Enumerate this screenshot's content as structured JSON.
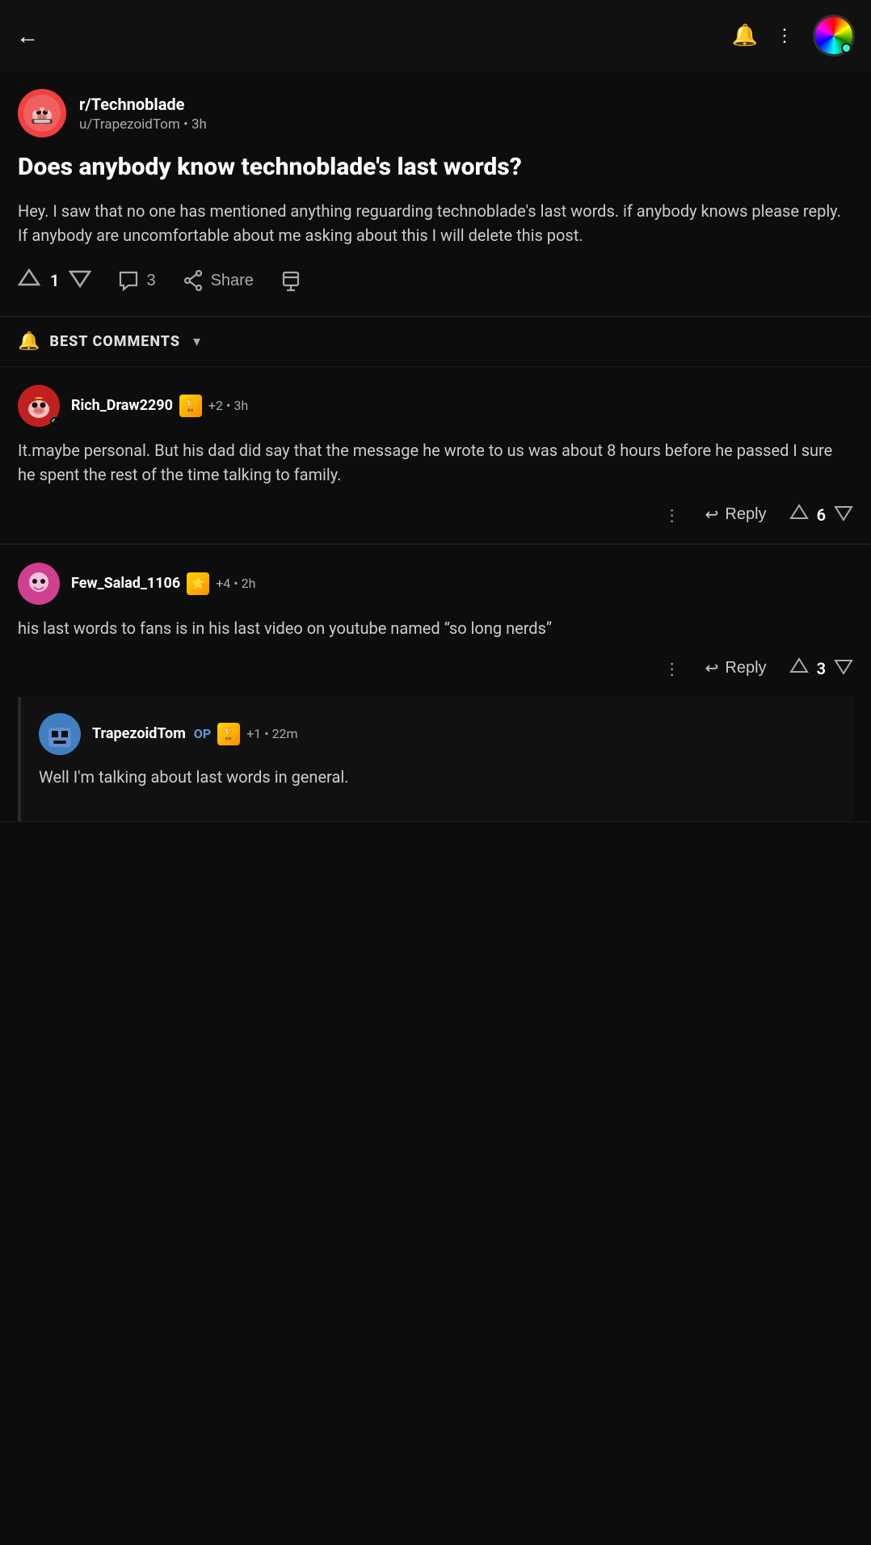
{
  "topbar": {
    "back_label": "←",
    "more_label": "⋮"
  },
  "post": {
    "subreddit": "r/Technoblade",
    "author": "u/TrapezoidTom",
    "time_ago": "3h",
    "title": "Does anybody know technoblade's last words?",
    "body": "Hey. I saw that no one has mentioned anything reguarding technoblade's last words. if anybody knows please reply. If anybody are uncomfortable about me asking about this I will delete this post.",
    "upvotes": "1",
    "comment_count": "3",
    "share_label": "Share"
  },
  "sort_bar": {
    "label": "BEST COMMENTS",
    "icon": "🔔"
  },
  "comments": [
    {
      "username": "Rich_Draw2290",
      "flair_points": "+2",
      "time_ago": "3h",
      "body": "It.maybe personal. But his dad did say that the message he wrote to us was about 8 hours before he passed I sure he spent the rest of the time talking to family.",
      "votes": "6",
      "reply_label": "Reply",
      "has_online": true
    },
    {
      "username": "Few_Salad_1106",
      "flair_points": "+4",
      "time_ago": "2h",
      "body": "his last words to fans is in his last video on youtube named “so long nerds”",
      "votes": "3",
      "reply_label": "Reply",
      "has_online": false,
      "nested": {
        "username": "TrapezoidTom",
        "op_label": "OP",
        "flair_points": "+1",
        "time_ago": "22m",
        "body": "Well I'm talking about last words in general."
      }
    }
  ]
}
